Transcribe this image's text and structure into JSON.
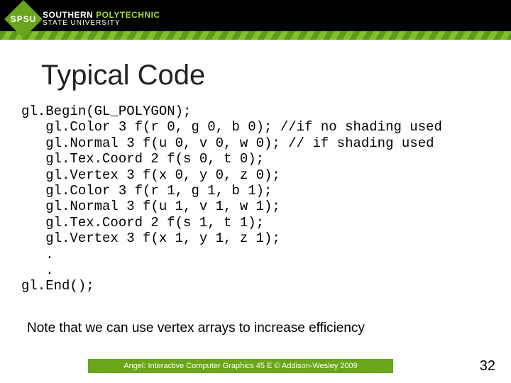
{
  "logo": {
    "badge": "SPSU",
    "line1a": "SOUTHERN",
    "line1b": " POLYTECHNIC",
    "line2": "STATE UNIVERSITY"
  },
  "title": "Typical Code",
  "code": "gl.Begin(GL_POLYGON);\n   gl.Color 3 f(r 0, g 0, b 0); //if no shading used\n   gl.Normal 3 f(u 0, v 0, w 0); // if shading used\n   gl.Tex.Coord 2 f(s 0, t 0);\n   gl.Vertex 3 f(x 0, y 0, z 0);\n   gl.Color 3 f(r 1, g 1, b 1);\n   gl.Normal 3 f(u 1, v 1, w 1);\n   gl.Tex.Coord 2 f(s 1, t 1);\n   gl.Vertex 3 f(x 1, y 1, z 1);\n   .\n   .\ngl.End();",
  "note": "Note that we can use vertex arrays to increase efficiency",
  "footer": "Angel: Interactive Computer Graphics 45 E © Addison-Wesley 2009",
  "pagenum": "32"
}
